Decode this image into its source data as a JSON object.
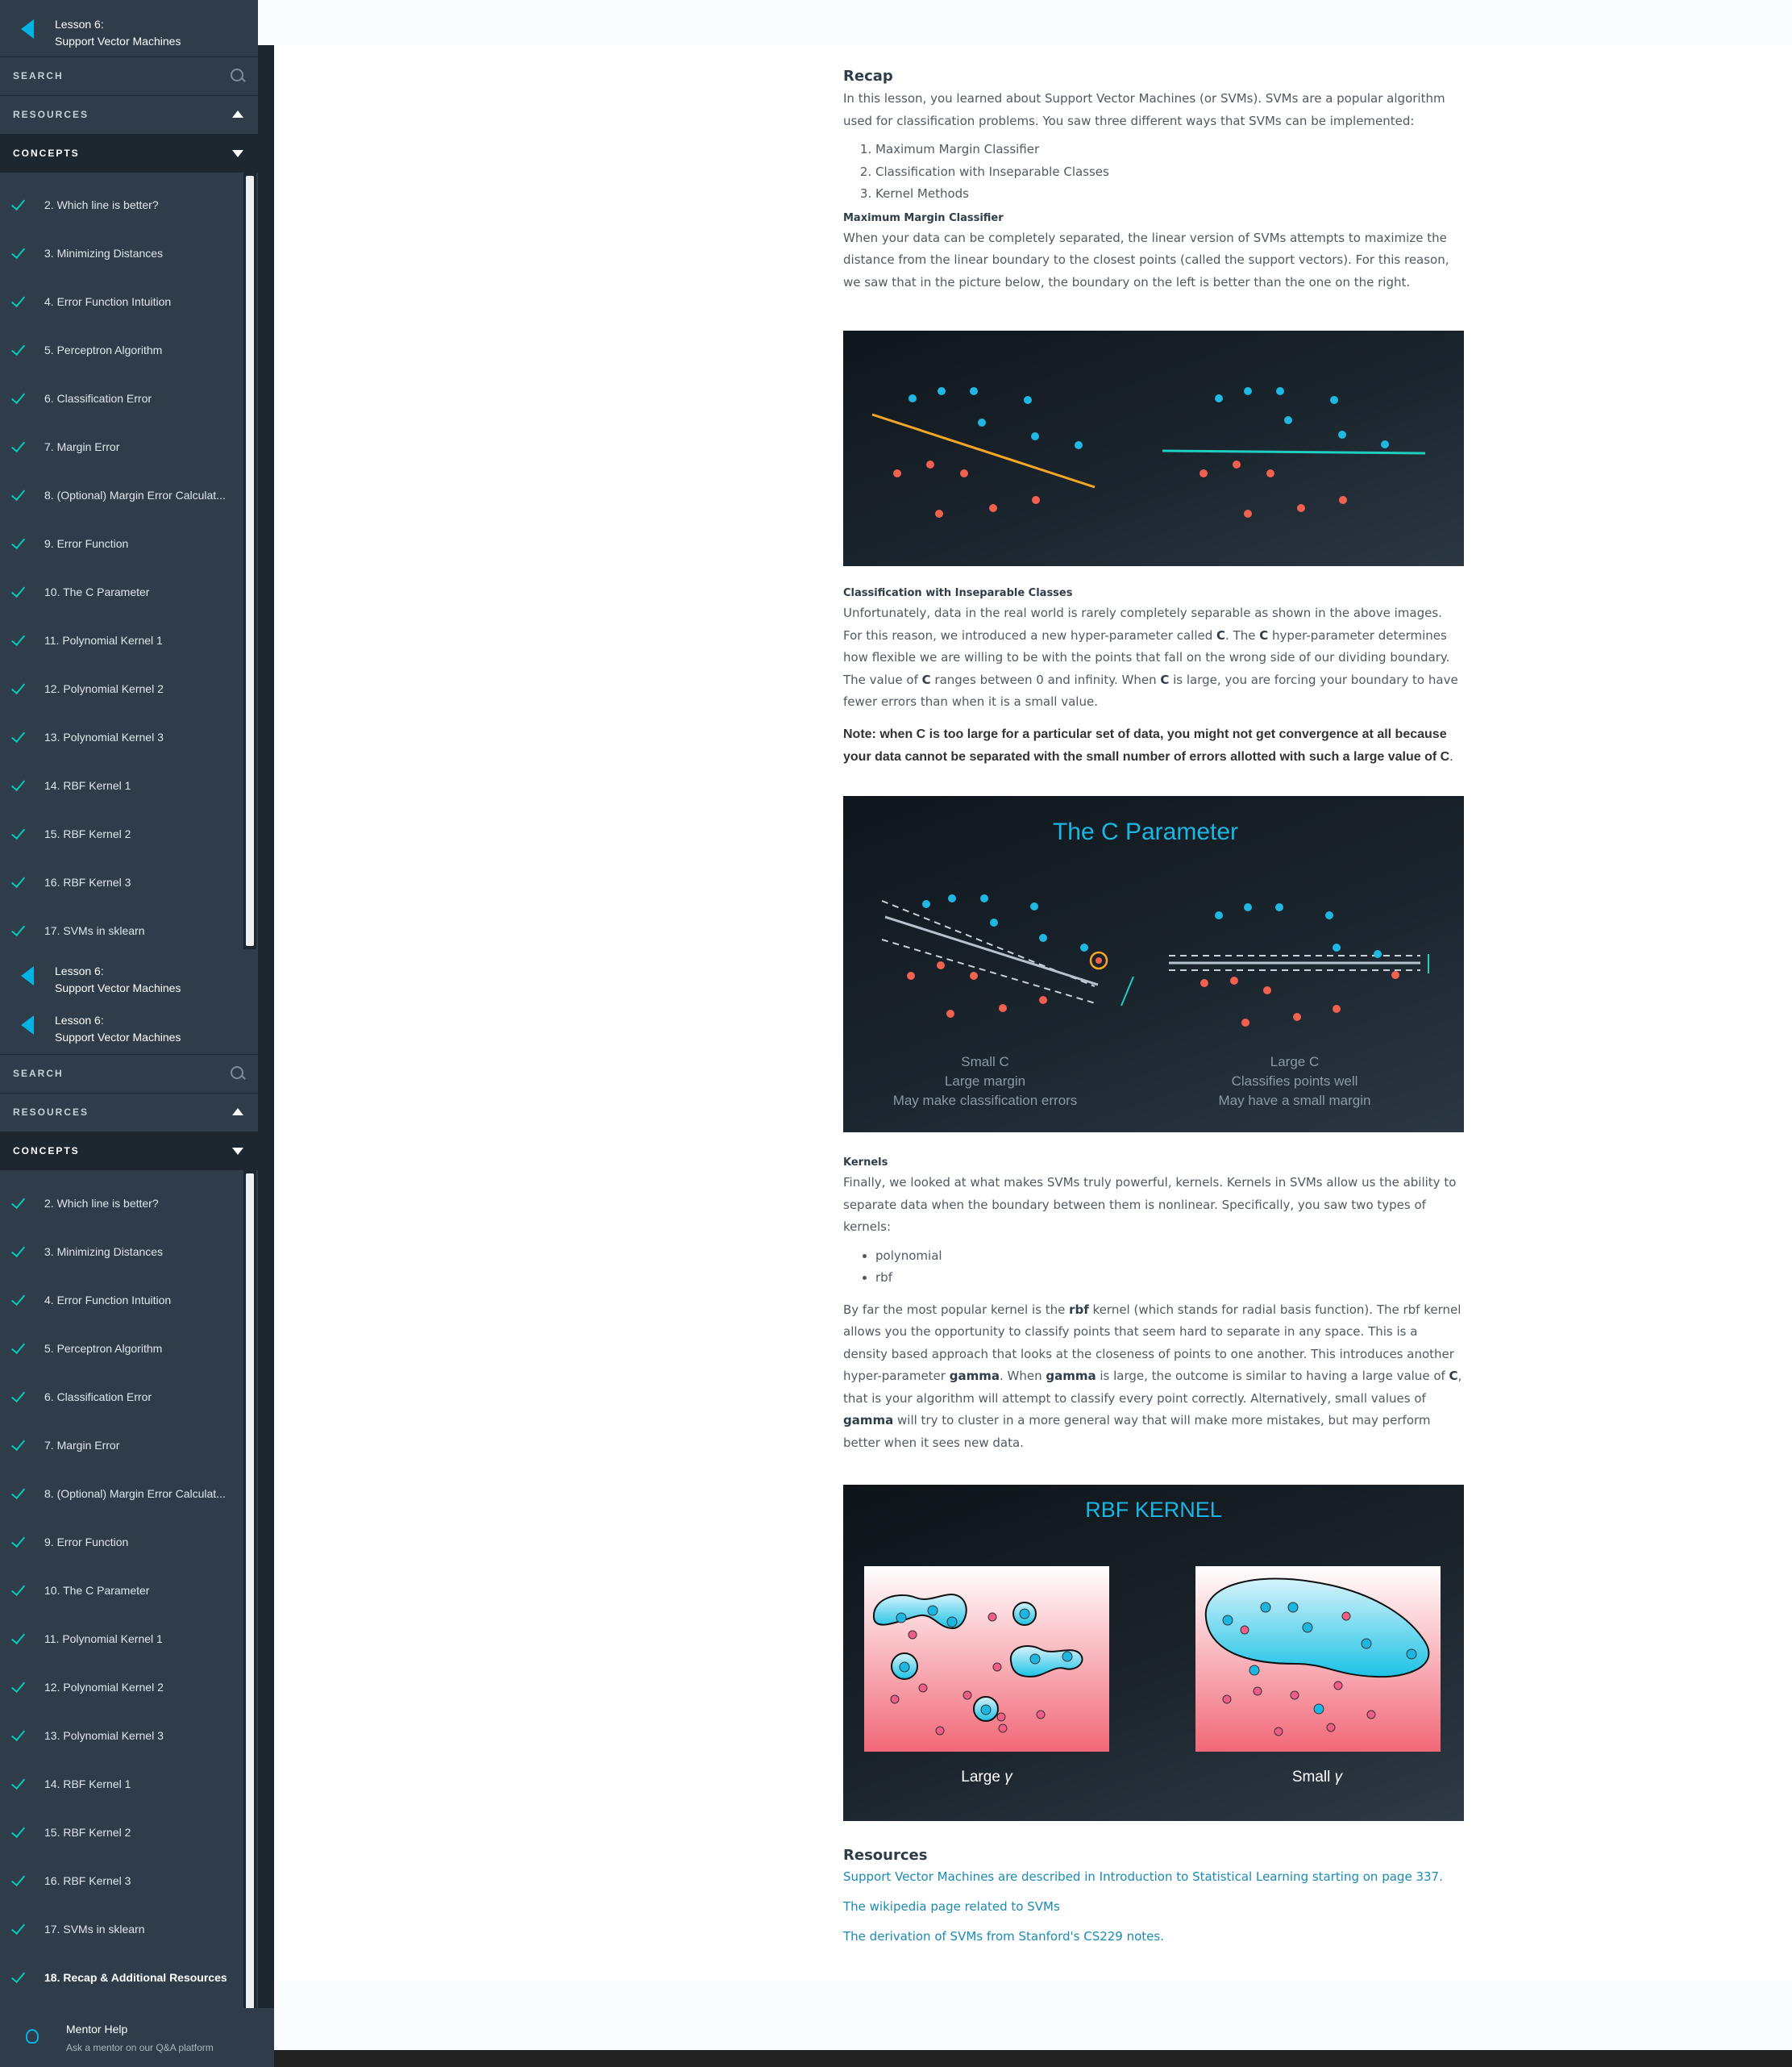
{
  "sidebar": {
    "lesson_label": "Lesson 6:",
    "lesson_title": "Support Vector Machines",
    "search_label": "SEARCH",
    "resources_label": "RESOURCES",
    "concepts_label": "CONCEPTS",
    "concepts": [
      "2. Which line is better?",
      "3. Minimizing Distances",
      "4. Error Function Intuition",
      "5. Perceptron Algorithm",
      "6. Classification Error",
      "7. Margin Error",
      "8. (Optional) Margin Error Calculat...",
      "9. Error Function",
      "10. The C Parameter",
      "11. Polynomial Kernel 1",
      "12. Polynomial Kernel 2",
      "13. Polynomial Kernel 3",
      "14. RBF Kernel 1",
      "15. RBF Kernel 2",
      "16. RBF Kernel 3",
      "17. SVMs in sklearn"
    ],
    "active_concept": "18. Recap & Additional Resources",
    "mentor_title": "Mentor Help",
    "mentor_sub": "Ask a mentor on our Q&A platform"
  },
  "content": {
    "recap_title": "Recap",
    "intro": "In this lesson, you learned about Support Vector Machines (or SVMs). SVMs are a popular algorithm used for classification problems. You saw three different ways that SVMs can be implemented:",
    "ways": [
      "Maximum Margin Classifier",
      "Classification with Inseparable Classes",
      "Kernel Methods"
    ],
    "mmc_title": "Maximum Margin Classifier",
    "mmc_text": "When your data can be completely separated, the linear version of SVMs attempts to maximize the distance from the linear boundary to the closest points (called the support vectors). For this reason, we saw that in the picture below, the boundary on the left is better than the one on the right.",
    "cwic_title": "Classification with Inseparable Classes",
    "cwic_p1": "Unfortunately, data in the real world is rarely completely separable as shown in the above images. For this reason, we introduced a new hyper-parameter called ",
    "c": "C",
    "cwic_p2": ". The ",
    "cwic_p3": " hyper-parameter determines how flexible we are willing to be with the points that fall on the wrong side of our dividing boundary. The value of ",
    "cwic_p4": " ranges between 0 and infinity. When ",
    "cwic_p5": " is large, you are forcing your boundary to have fewer errors than when it is a small value.",
    "note": "Note: when C is too large for a particular set of data, you might not get convergence at all because your data cannot be separated with the small number of errors allotted with such a large value of C",
    "note_end": ".",
    "c_fig": {
      "title": "The C Parameter",
      "left_caption": [
        "Small C",
        "Large margin",
        "May make classification errors"
      ],
      "right_caption": [
        "Large C",
        "Classifies points well",
        "May have a small margin"
      ]
    },
    "kernels_title": "Kernels",
    "kernels_text": "Finally, we looked at what makes SVMs truly powerful, kernels. Kernels in SVMs allow us the ability to separate data when the boundary between them is nonlinear. Specifically, you saw two types of kernels:",
    "kernel_types": [
      "polynomial",
      "rbf"
    ],
    "rbf_p1": "By far the most popular kernel is the ",
    "rbf": "rbf",
    "rbf_p2": " kernel (which stands for radial basis function). The rbf kernel allows you the opportunity to classify points that seem hard to separate in any space. This is a density based approach that looks at the closeness of points to one another. This introduces another hyper-parameter ",
    "gamma": "gamma",
    "rbf_p3": ". When ",
    "rbf_p4": " is large, the outcome is similar to having a large value of ",
    "rbf_p5": ", that is your algorithm will attempt to classify every point correctly. Alternatively, small values of ",
    "rbf_p6": " will try to cluster in a more general way that will make more mistakes, but may perform better when it sees new data.",
    "rbf_fig": {
      "title": "RBF KERNEL",
      "left_caption": "Large",
      "right_caption": "Small",
      "gamma_symbol": "γ"
    },
    "resources_title": "Resources",
    "links": [
      "Support Vector Machines are described in Introduction to Statistical Learning starting on page 337.",
      "The wikipedia page related to SVMs",
      "The derivation of SVMs from Stanford's CS229 notes."
    ]
  }
}
